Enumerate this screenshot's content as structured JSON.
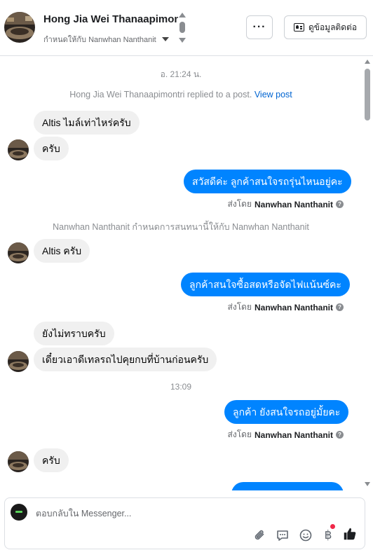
{
  "header": {
    "name": "Hong Jia Wei Thanaapimontri",
    "assigned_text": "กำหนดให้กับ Nanwhan Nanthanit",
    "more_label": "···",
    "contact_label": "ดูข้อมูลติดต่อ"
  },
  "chat": {
    "time_1": "อ. 21:24 น.",
    "replied_text": "Hong Jia Wei Thanaapimontri replied to a post.",
    "view_post_label": "View post",
    "msg_in_1": "Altis ไมล์เท่าไหร่ครับ",
    "msg_in_2": "ครับ",
    "msg_out_1": "สวัสดีค่ะ ลูกค้าสนใจรถรุ่นไหนอยู่คะ",
    "sent_by_prefix": "ส่งโดย",
    "sent_by_name": "Nanwhan Nanthanit",
    "assign_event": "Nanwhan Nanthanit กำหนดการสนทนานี้ให้กับ Nanwhan Nanthanit",
    "msg_in_3": "Altis ครับ",
    "msg_out_2": "ลูกค้าสนใจซื้อสดหรือจัดไฟแน้นซ์คะ",
    "msg_in_4": "ยังไม่ทราบครับ",
    "msg_in_5": "เดี๋ยวเอาดีเทลรถไปคุยกบที่บ้านก่อนครับ",
    "time_2": "13:09",
    "msg_out_3": "ลูกค้า ยังสนใจรถอยู่มั้ยคะ",
    "msg_in_6": "ครับ"
  },
  "composer": {
    "placeholder": "ตอบกลับใน Messenger..."
  },
  "icons": {
    "attach": "paperclip-icon",
    "saved_replies": "speech-bubble-icon",
    "emoji": "smiley-icon",
    "payment": "baht-icon",
    "like": "thumbs-up-icon"
  },
  "colors": {
    "outgoing_bubble": "#0084ff",
    "incoming_bubble": "#f0f0f0",
    "like_icon": "#1c1e21",
    "notification_dot": "#f02849",
    "link": "#0064d1"
  }
}
